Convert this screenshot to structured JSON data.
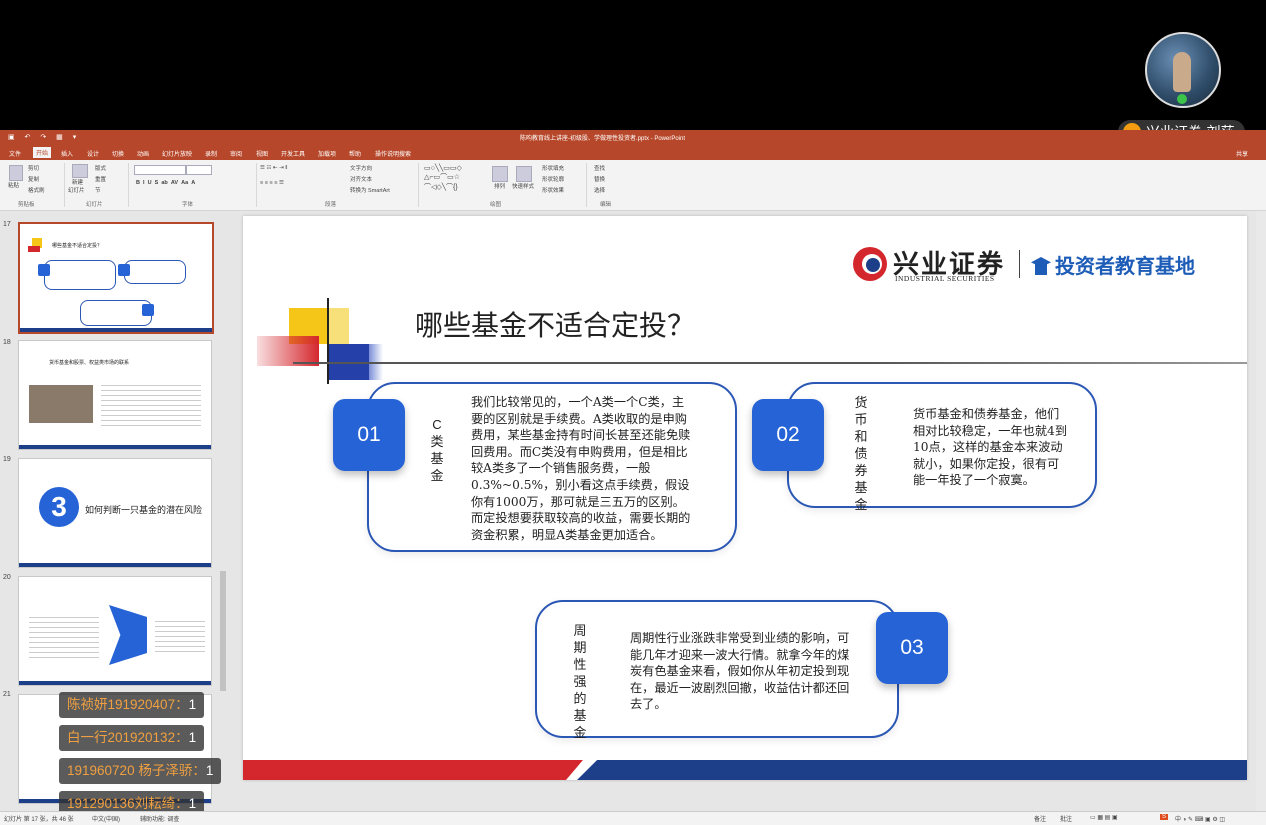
{
  "presenter": {
    "name": "兴业证券-刘莎"
  },
  "ppt": {
    "window_title": "陈昀教育线上讲座-初级股、学做理性投资者.pptx - PowerPoint",
    "tabs": [
      "文件",
      "开始",
      "插入",
      "设计",
      "切换",
      "动画",
      "幻灯片放映",
      "录制",
      "审阅",
      "视图",
      "开发工具",
      "加载项",
      "帮助",
      "操作说明搜索"
    ],
    "active_tab": "开始",
    "share": "共享",
    "ribbon": {
      "clipboard": {
        "paste": "粘贴",
        "cut": "剪切",
        "copy": "复制",
        "format_painter": "格式刷",
        "group": "剪贴板"
      },
      "slides": {
        "new": "新建",
        "new2": "幻灯片",
        "layout": "版式",
        "reset": "重置",
        "section": "节",
        "group": "幻灯片"
      },
      "font": {
        "group": "字体"
      },
      "paragraph": {
        "direction": "文字方向",
        "align": "对齐文本",
        "smartart": "转换为 SmartArt",
        "group": "段落"
      },
      "drawing": {
        "arrange": "排列",
        "quick": "快速样式",
        "fill": "形状填充",
        "outline": "形状轮廓",
        "effect": "形状效果",
        "group": "绘图"
      },
      "editing": {
        "find": "查找",
        "replace": "替换",
        "select": "选择",
        "group": "编辑"
      }
    }
  },
  "thumbnails": [
    {
      "num": "17",
      "title": "哪些基金不适合定投？",
      "selected": true
    },
    {
      "num": "18",
      "title": "货币基金和股票、权益类市场的联系",
      "selected": false
    },
    {
      "num": "19",
      "title": "如何判断一只基金的潜在风险",
      "selected": false
    },
    {
      "num": "20",
      "title": "",
      "selected": false
    },
    {
      "num": "21",
      "title": "",
      "selected": false
    }
  ],
  "slide": {
    "logo_cn": "兴业证券",
    "logo_en": "INDUSTRIAL SECURITIES",
    "logo_edu": "投资者教育基地",
    "title": "哪些基金不适合定投？",
    "cards": [
      {
        "badge": "01",
        "label": "C类基金",
        "text": "我们比较常见的，一个A类一个C类，主要的区别就是手续费。A类收取的是申购费用，某些基金持有时间长甚至还能免赎回费用。而C类没有申购费用，但是相比较A类多了一个销售服务费，一般0.3%~0.5%，别小看这点手续费，假设你有1000万，那可就是三五万的区别。而定投想要获取较高的收益，需要长期的资金积累，明显A类基金更加适合。"
      },
      {
        "badge": "02",
        "label": "货币和债券基金",
        "text": "货币基金和债券基金，他们相对比较稳定，一年也就4到10点，这样的基金本来波动就小，如果你定投，很有可能一年投了一个寂寞。"
      },
      {
        "badge": "03",
        "label": "周期性强的基金",
        "text": "周期性行业涨跌非常受到业绩的影响，可能几年才迎来一波大行情。就拿今年的煤炭有色基金来看，假如你从年初定投到现在，最近一波剧烈回撤，收益估计都还回去了。"
      }
    ]
  },
  "chat": [
    {
      "name": "陈祯妍191920407：",
      "count": "1"
    },
    {
      "name": "白一行201920132：",
      "count": "1"
    },
    {
      "name": "191960720 杨子泽骄：",
      "count": "1"
    },
    {
      "name": "191290136刘耘绮：",
      "count": "1"
    }
  ],
  "status": {
    "slide_info": "幻灯片 第 17 张，共 46 张",
    "lang": "中文(中国)",
    "access": "辅助功能: 调查",
    "notes": "备注",
    "comments": "批注"
  },
  "colors": {
    "accent": "#b7472a",
    "brand_red": "#d4272d",
    "brand_blue": "#1d3f8a",
    "badge_blue": "#2563d6"
  }
}
